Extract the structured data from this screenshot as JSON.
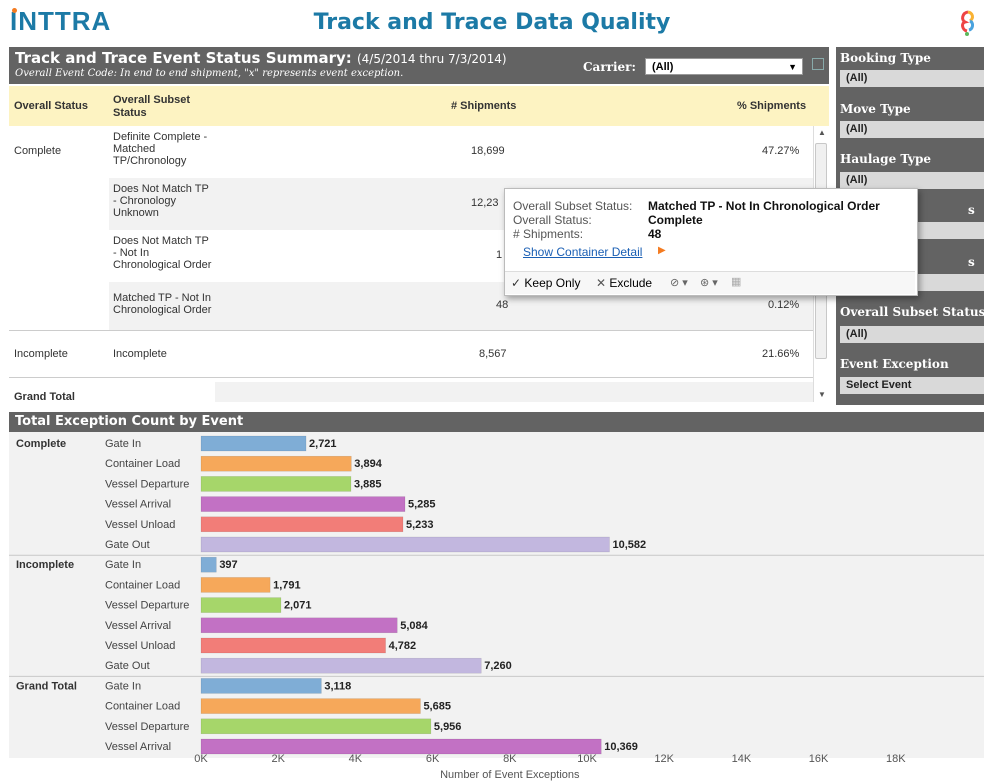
{
  "header": {
    "logo": "INTTRA",
    "title": "Track and Trace Data Quality"
  },
  "summary": {
    "title": "Track and Trace Event Status Summary:",
    "date_range": "(4/5/2014 thru 7/3/2014)",
    "subtitle": "Overall Event Code: In end to end shipment, \"x\" represents event exception.",
    "carrier_label": "Carrier:",
    "carrier_value": "(All)",
    "columns": [
      "Overall Status",
      "Overall Subset Status",
      "# Shipments",
      "% Shipments"
    ],
    "rows": [
      {
        "status": "Complete",
        "subset": "Definite Complete - Matched TP/Chronology",
        "shipments": "18,699",
        "pct": "47.27%"
      },
      {
        "status": "",
        "subset": "Does Not Match TP - Chronology Unknown",
        "shipments": "12,23",
        "pct": ""
      },
      {
        "status": "",
        "subset": "Does Not Match TP - Not In Chronological Order",
        "shipments": "1",
        "pct": ""
      },
      {
        "status": "",
        "subset": "Matched TP - Not In Chronological Order",
        "shipments": "48",
        "pct": "0.12%"
      },
      {
        "status": "Incomplete",
        "subset": "Incomplete",
        "shipments": "8,567",
        "pct": "21.66%"
      },
      {
        "status": "Grand Total",
        "subset": "",
        "shipments": "",
        "pct": ""
      }
    ]
  },
  "filters": [
    {
      "label": "Booking Type",
      "value": "(All)"
    },
    {
      "label": "Move Type",
      "value": "(All)"
    },
    {
      "label": "Haulage Type",
      "value": "(All)"
    },
    {
      "label": "s",
      "value": ""
    },
    {
      "label": "s",
      "value": ""
    },
    {
      "label": "Overall Subset Status",
      "value": "(All)"
    },
    {
      "label": "Event Exception",
      "value": "Select Event"
    }
  ],
  "tooltip": {
    "subset_key": "Overall Subset Status:",
    "subset_val": "Matched TP - Not In Chronological Order",
    "status_key": "Overall Status:",
    "status_val": "Complete",
    "ship_key": "# Shipments:",
    "ship_val": "48",
    "link": "Show Container Detail",
    "keep_only": "Keep Only",
    "exclude": "Exclude"
  },
  "colors": {
    "header_bg": "#636363",
    "accent": "#1c7aa6",
    "highlight": "#fdf3c2"
  },
  "chart_data": {
    "type": "bar",
    "title": "Total Exception Count by Event",
    "xlabel": "Number of Event Exceptions",
    "xlim": [
      0,
      19000
    ],
    "xticks": [
      "0K",
      "2K",
      "4K",
      "6K",
      "8K",
      "10K",
      "12K",
      "14K",
      "16K",
      "18K"
    ],
    "event_colors": {
      "Gate In": "#7fadd6",
      "Container Load": "#f6a85a",
      "Vessel Departure": "#a6d66a",
      "Vessel Arrival": "#c271c4",
      "Vessel Unload": "#f27d78",
      "Gate Out": "#c2b7df"
    },
    "groups": [
      {
        "name": "Complete",
        "bars": [
          {
            "event": "Gate In",
            "value": 2721,
            "label": "2,721"
          },
          {
            "event": "Container Load",
            "value": 3894,
            "label": "3,894"
          },
          {
            "event": "Vessel Departure",
            "value": 3885,
            "label": "3,885"
          },
          {
            "event": "Vessel Arrival",
            "value": 5285,
            "label": "5,285"
          },
          {
            "event": "Vessel Unload",
            "value": 5233,
            "label": "5,233"
          },
          {
            "event": "Gate Out",
            "value": 10582,
            "label": "10,582"
          }
        ]
      },
      {
        "name": "Incomplete",
        "bars": [
          {
            "event": "Gate In",
            "value": 397,
            "label": "397"
          },
          {
            "event": "Container Load",
            "value": 1791,
            "label": "1,791"
          },
          {
            "event": "Vessel Departure",
            "value": 2071,
            "label": "2,071"
          },
          {
            "event": "Vessel Arrival",
            "value": 5084,
            "label": "5,084"
          },
          {
            "event": "Vessel Unload",
            "value": 4782,
            "label": "4,782"
          },
          {
            "event": "Gate Out",
            "value": 7260,
            "label": "7,260"
          }
        ]
      },
      {
        "name": "Grand Total",
        "bars": [
          {
            "event": "Gate In",
            "value": 3118,
            "label": "3,118"
          },
          {
            "event": "Container Load",
            "value": 5685,
            "label": "5,685"
          },
          {
            "event": "Vessel Departure",
            "value": 5956,
            "label": "5,956"
          },
          {
            "event": "Vessel Arrival",
            "value": 10369,
            "label": "10,369"
          }
        ]
      }
    ]
  }
}
